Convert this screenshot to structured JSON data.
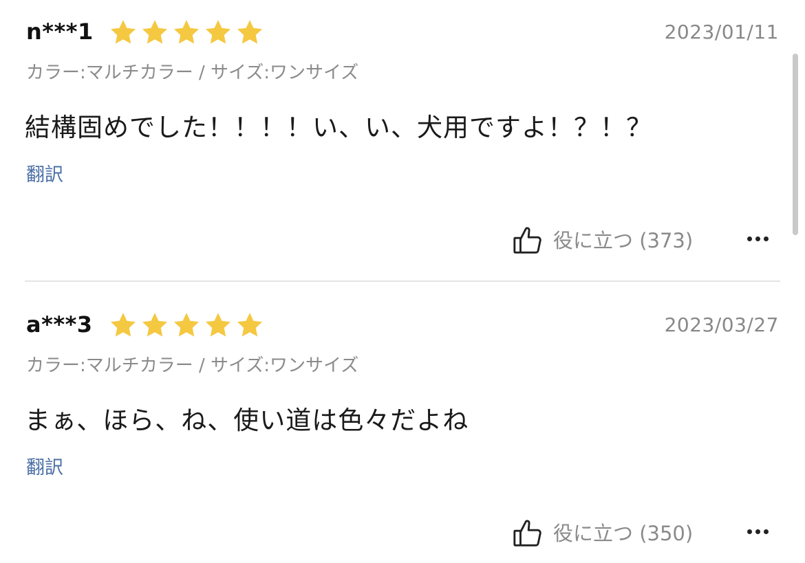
{
  "reviews": [
    {
      "user": "n***1",
      "rating": 5,
      "date": "2023/01/11",
      "variant": "カラー:マルチカラー / サイズ:ワンサイズ",
      "text": "結構固めでした！！！！い、い、犬用ですよ！？！？",
      "translate_label": "翻訳",
      "helpful_label": "役に立つ (373)"
    },
    {
      "user": "a***3",
      "rating": 5,
      "date": "2023/03/27",
      "variant": "カラー:マルチカラー / サイズ:ワンサイズ",
      "text": "まぁ、ほら、ね、使い道は色々だよね",
      "translate_label": "翻訳",
      "helpful_label": "役に立つ (350)"
    }
  ],
  "icons": {
    "star": "star-icon",
    "thumb": "thumbs-up-icon",
    "more": "more-options-icon"
  },
  "colors": {
    "star": "#F5C842",
    "link": "#4A6FA5",
    "muted": "#8A8A8A"
  }
}
